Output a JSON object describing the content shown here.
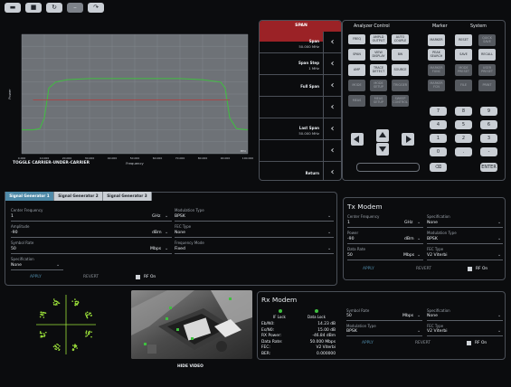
{
  "toolbar": {
    "icons": [
      "folder-icon",
      "save-icon",
      "refresh-icon",
      "minus-icon",
      "redo-icon"
    ]
  },
  "chart_data": {
    "type": "line",
    "title": "",
    "xlabel": "Frequency",
    "ylabel": "Power",
    "unit_note": "MHz",
    "x_ticks": [
      "0.000",
      "10.000",
      "20.000",
      "30.000",
      "40.000",
      "50.000",
      "60.000",
      "70.000",
      "80.000",
      "90.000",
      "100.000"
    ],
    "y_ticks": [],
    "series": [
      {
        "name": "",
        "color": "#3fbf3f",
        "x": [
          0,
          5,
          8,
          10,
          12,
          15,
          20,
          30,
          40,
          50,
          60,
          70,
          80,
          88,
          90,
          92,
          95,
          100
        ],
        "y": [
          -80,
          -80,
          -79,
          -70,
          -45,
          -40,
          -38,
          -37,
          -37,
          -37,
          -37,
          -37,
          -38,
          -40,
          -45,
          -70,
          -79,
          -80
        ]
      },
      {
        "name": "",
        "color": "#b83a3a",
        "x": [
          5,
          92
        ],
        "y": [
          -55,
          -55
        ]
      }
    ],
    "ylim": [
      -100,
      0
    ],
    "xlim": [
      0,
      100
    ],
    "grid": true
  },
  "toggle_label": "TOGGLE CARRIER-UNDER-CARRIER",
  "span": {
    "header": "SPAN",
    "rows": [
      {
        "title": "Span",
        "value": "50.000 MHz"
      },
      {
        "title": "Span Step",
        "value": "1 MHz"
      },
      {
        "title": "Full Span",
        "value": ""
      },
      {
        "title": "",
        "value": ""
      },
      {
        "title": "Last Span",
        "value": "50.000 MHz"
      },
      {
        "title": "",
        "value": ""
      },
      {
        "title": "Return",
        "value": ""
      }
    ]
  },
  "analyzer": {
    "header": "Analyzer Control",
    "buttons": [
      [
        "FREQ",
        "AMPLD OUTPUT",
        "AUTO COUPLE"
      ],
      [
        "SPAN",
        "VIEW DISPLAY",
        "BW"
      ],
      [
        "AMP",
        "TRACE DETECT",
        "SOURCE"
      ],
      [
        "MODE",
        "MODE SETUP",
        "TRIGGER"
      ],
      [
        "MEAS",
        "MEAS SETUP",
        "SWEEP CONTROL"
      ]
    ]
  },
  "marker": {
    "header": "Marker",
    "buttons": [
      "MARKER",
      "PEAK SEARCH",
      "MARKER FUNC",
      "MARKER FCN"
    ]
  },
  "system": {
    "header": "System",
    "buttons": [
      "RESET",
      "QUICK SAVE",
      "SAVE",
      "RECALL",
      "MODE PRESET",
      "USER PRESET",
      "FILE",
      "PRINT"
    ]
  },
  "keypad": {
    "keys": [
      "7",
      "8",
      "9",
      "4",
      "5",
      "6",
      "1",
      "2",
      "3",
      "0",
      ".",
      "-",
      "⌫",
      "",
      "ENTER"
    ]
  },
  "siggen": {
    "tabs": [
      "Signal Generator 1",
      "Signal Generator 2",
      "Signal Generator 3"
    ],
    "center_freq_label": "Center Frequency",
    "center_freq_value": "1",
    "center_freq_unit": "GHz",
    "modulation_type_label": "Modulation Type",
    "modulation_type_value": "BPSK",
    "amplitude_label": "Amplitude",
    "amplitude_value": "-90",
    "amplitude_unit": "dBm",
    "fec_type_label": "FEC Type",
    "fec_type_value": "None",
    "symbol_rate_label": "Symbol Rate",
    "symbol_rate_value": "50",
    "symbol_rate_unit": "Mbps",
    "freq_mode_label": "Frequency Mode",
    "freq_mode_value": "Fixed",
    "spec_label": "Specification",
    "spec_value": "None",
    "apply": "APPLY",
    "revert": "REVERT",
    "rf_on": "RF On"
  },
  "tx": {
    "title": "Tx Modem",
    "center_freq_label": "Center Frequency",
    "center_freq_value": "1",
    "center_freq_unit": "GHz",
    "spec_label": "Specification",
    "spec_value": "None",
    "power_label": "Power",
    "power_value": "-90",
    "power_unit": "dBm",
    "mod_label": "Modulation Type",
    "mod_value": "BPSK",
    "data_rate_label": "Data Rate",
    "data_rate_value": "50",
    "data_rate_unit": "Mbps",
    "fec_label": "FEC Type",
    "fec_value": "V2 Viterbi",
    "apply": "APPLY",
    "revert": "REVERT",
    "rf_on": "RF On"
  },
  "rx": {
    "title": "Rx Modem",
    "if_lock": "IF Lock",
    "data_lock": "Data Lock",
    "stats": [
      {
        "k": "Eb/N0:",
        "v": "14.23 dB"
      },
      {
        "k": "Es/N0:",
        "v": "15.00 dB"
      },
      {
        "k": "RX Power:",
        "v": "-46.84 dBm"
      },
      {
        "k": "Data Rate:",
        "v": "50.000 Mbps"
      },
      {
        "k": "FEC:",
        "v": "V2 Viterbi"
      },
      {
        "k": "BER:",
        "v": "0.000000"
      }
    ],
    "symbol_rate_label": "Symbol Rate",
    "symbol_rate_value": "50",
    "symbol_rate_unit": "Mbps",
    "spec_label": "Specification",
    "spec_value": "None",
    "mod_label": "Modulation Type",
    "mod_value": "BPSK",
    "fec_label": "FEC Type",
    "fec_value": "V2 Viterbi",
    "apply": "APPLY",
    "revert": "REVERT",
    "rf_on": "RF On"
  },
  "video": {
    "caption": "HIDE VIDEO"
  },
  "colors": {
    "accent": "#4f8aa8",
    "trace": "#3fbf3f",
    "limit": "#b83a3a",
    "span_header": "#9b2226",
    "constellation": "#9be03a"
  }
}
